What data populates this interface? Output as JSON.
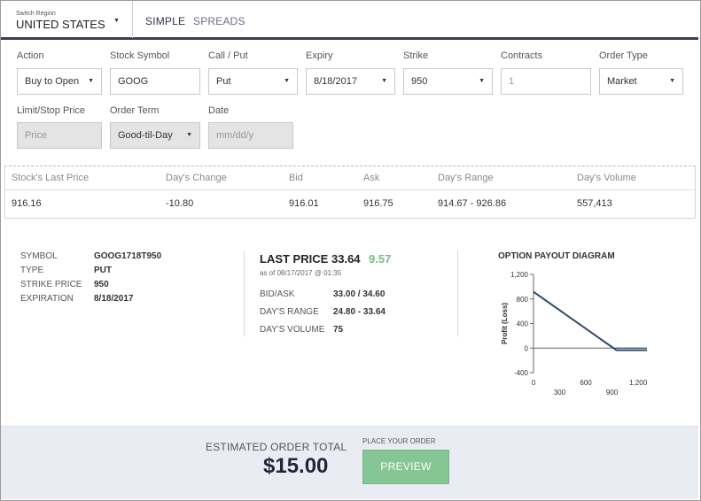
{
  "header": {
    "region_label": "Switch Region",
    "region_value": "UNITED STATES",
    "tabs": [
      {
        "label": "SIMPLE"
      },
      {
        "label": "SPREADS"
      }
    ]
  },
  "form": {
    "action": {
      "label": "Action",
      "value": "Buy to Open"
    },
    "symbol": {
      "label": "Stock Symbol",
      "value": "GOOG"
    },
    "callput": {
      "label": "Call / Put",
      "value": "Put"
    },
    "expiry": {
      "label": "Expiry",
      "value": "8/18/2017"
    },
    "strike": {
      "label": "Strike",
      "value": "950"
    },
    "contracts": {
      "label": "Contracts",
      "value": "1"
    },
    "ordertype": {
      "label": "Order Type",
      "value": "Market"
    },
    "limit": {
      "label": "Limit/Stop Price",
      "placeholder": "Price"
    },
    "term": {
      "label": "Order Term",
      "value": "Good-til-Day"
    },
    "date": {
      "label": "Date",
      "placeholder": "mm/dd/y"
    }
  },
  "quote": {
    "headers": [
      "Stock's Last Price",
      "Day's Change",
      "Bid",
      "Ask",
      "Day's Range",
      "Day's Volume"
    ],
    "values": [
      "916.16",
      "-10.80",
      "916.01",
      "916.75",
      "914.67 - 926.86",
      "557,413"
    ]
  },
  "details": {
    "symbol_label": "SYMBOL",
    "symbol_value": "GOOG1718T950",
    "type_label": "TYPE",
    "type_value": "PUT",
    "strike_label": "STRIKE PRICE",
    "strike_value": "950",
    "exp_label": "EXPIRATION",
    "exp_value": "8/18/2017"
  },
  "pricing": {
    "last_price_label": "LAST PRICE",
    "last_price": "33.64",
    "change": "9.57",
    "as_of": "as of 08/17/2017 @ 01:35",
    "bidask_label": "BID/ASK",
    "bidask_value": "33.00 / 34.60",
    "range_label": "DAY'S RANGE",
    "range_value": "24.80 - 33.64",
    "volume_label": "DAY'S VOLUME",
    "volume_value": "75"
  },
  "chart_data": {
    "type": "line",
    "title": "OPTION PAYOUT DIAGRAM",
    "ylabel": "Profit (Loss)",
    "xlabel": "",
    "x": [
      0,
      916,
      950,
      1300
    ],
    "y": [
      916,
      0,
      -34,
      -34
    ],
    "baseline": {
      "x": [
        916,
        1300
      ],
      "y": [
        0,
        0
      ]
    },
    "xlim": [
      0,
      1300
    ],
    "ylim": [
      -400,
      1200
    ],
    "xticks": [
      "0",
      "300",
      "600",
      "900",
      "1,200"
    ],
    "yticks": [
      "1,200",
      "800",
      "400",
      "0",
      "-400"
    ],
    "line_color": "#2f4a6b",
    "grid": false
  },
  "footer": {
    "est_label": "ESTIMATED ORDER TOTAL",
    "est_total": "$15.00",
    "place_label": "PLACE YOUR ORDER",
    "preview_label": "PREVIEW"
  }
}
